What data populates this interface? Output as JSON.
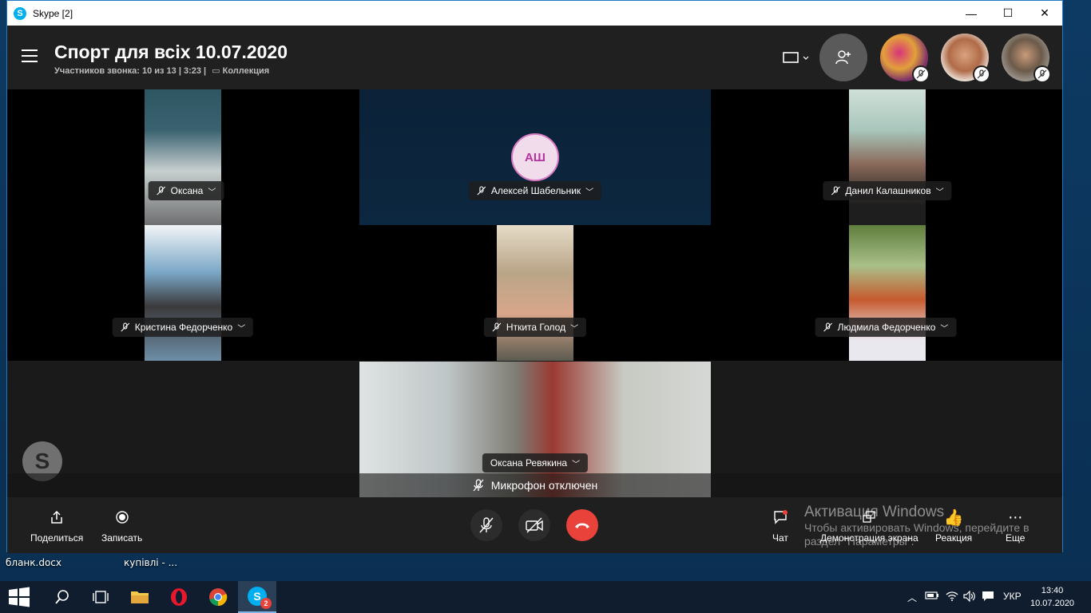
{
  "window": {
    "title": "Skype [2]",
    "minimize": "—",
    "maximize": "☐",
    "close": "✕"
  },
  "desktop": {
    "icons": [
      {
        "label": "бланк.docx"
      },
      {
        "label": "купівлі  - ..."
      }
    ]
  },
  "call": {
    "title": "Спорт для всіх 10.07.2020",
    "subtitle": "Участников звонка: 10 из 13 | 3:23 |",
    "collection": "Коллекция"
  },
  "participants": [
    {
      "name": "Оксана",
      "muted": true
    },
    {
      "name": "Алексей Шабельник",
      "initials": "АШ",
      "muted": true
    },
    {
      "name": "Данил Калашников",
      "muted": true
    },
    {
      "name": "Кристина Федорченко",
      "muted": true
    },
    {
      "name": "Нткита Голод",
      "muted": true
    },
    {
      "name": "Людмила Федорченко",
      "muted": true
    },
    {
      "name": "Оксана Ревякина",
      "muted": false
    }
  ],
  "status": {
    "mic_off": "Микрофон отключен"
  },
  "bottom": {
    "share": "Поделиться",
    "record": "Записать",
    "chat": "Чат",
    "screen_share": "Демонстрация экрана",
    "reaction": "Реакция",
    "more": "Еще"
  },
  "activation": {
    "line1": "Активация Windows",
    "line2": "Чтобы активировать Windows, перейдите в",
    "line3": "раздел \"Параметры\"."
  },
  "taskbar": {
    "lang": "УКР",
    "time": "13:40",
    "date": "10.07.2020",
    "skype_badge": "2"
  },
  "colors": {
    "accent": "#00aff0",
    "end_call": "#e9423a",
    "initials_text": "#b3349c"
  }
}
